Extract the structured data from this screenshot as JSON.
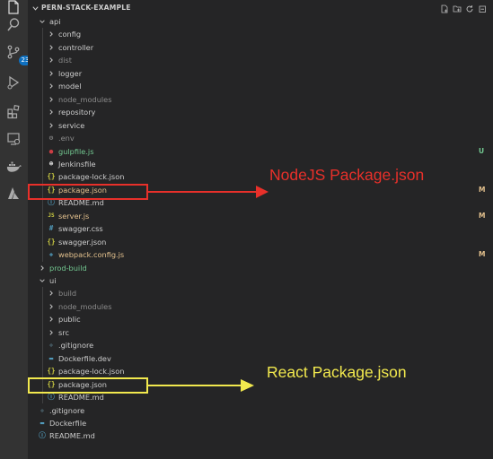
{
  "activity_bar": {
    "items": [
      {
        "name": "files-icon"
      },
      {
        "name": "search-icon"
      },
      {
        "name": "source-control-icon",
        "badge": "23"
      },
      {
        "name": "run-debug-icon"
      },
      {
        "name": "extensions-icon"
      },
      {
        "name": "remote-explorer-icon"
      },
      {
        "name": "docker-icon"
      },
      {
        "name": "azure-icon"
      }
    ]
  },
  "explorer": {
    "root": "PERN-STACK-EXAMPLE",
    "tree": [
      {
        "label": "api",
        "type": "folder",
        "open": true,
        "depth": 0
      },
      {
        "label": "config",
        "type": "folder",
        "open": false,
        "depth": 1
      },
      {
        "label": "controller",
        "type": "folder",
        "open": false,
        "depth": 1
      },
      {
        "label": "dist",
        "type": "folder",
        "open": false,
        "depth": 1,
        "dim": true
      },
      {
        "label": "logger",
        "type": "folder",
        "open": false,
        "depth": 1
      },
      {
        "label": "model",
        "type": "folder",
        "open": false,
        "depth": 1
      },
      {
        "label": "node_modules",
        "type": "folder",
        "open": false,
        "depth": 1,
        "dim": true
      },
      {
        "label": "repository",
        "type": "folder",
        "open": false,
        "depth": 1
      },
      {
        "label": "service",
        "type": "folder",
        "open": false,
        "depth": 1
      },
      {
        "label": ".env",
        "type": "file",
        "icon": "gear",
        "depth": 1,
        "dim": true
      },
      {
        "label": "gulpfile.js",
        "type": "file",
        "icon": "gulp",
        "depth": 1,
        "color": "untracked",
        "status": "U"
      },
      {
        "label": "Jenkinsfile",
        "type": "file",
        "icon": "jenkins",
        "depth": 1
      },
      {
        "label": "package-lock.json",
        "type": "file",
        "icon": "json",
        "depth": 1
      },
      {
        "label": "package.json",
        "type": "file",
        "icon": "json",
        "depth": 1,
        "color": "modified",
        "status": "M"
      },
      {
        "label": "README.md",
        "type": "file",
        "icon": "info",
        "depth": 1
      },
      {
        "label": "server.js",
        "type": "file",
        "icon": "js",
        "depth": 1,
        "color": "modified",
        "status": "M"
      },
      {
        "label": "swagger.css",
        "type": "file",
        "icon": "hash",
        "depth": 1
      },
      {
        "label": "swagger.json",
        "type": "file",
        "icon": "json",
        "depth": 1
      },
      {
        "label": "webpack.config.js",
        "type": "file",
        "icon": "webpack",
        "depth": 1,
        "color": "modified",
        "status": "M"
      },
      {
        "label": "prod-build",
        "type": "folder",
        "open": false,
        "depth": 0,
        "color": "untracked"
      },
      {
        "label": "ui",
        "type": "folder",
        "open": true,
        "depth": 0
      },
      {
        "label": "build",
        "type": "folder",
        "open": false,
        "depth": 1,
        "dim": true
      },
      {
        "label": "node_modules",
        "type": "folder",
        "open": false,
        "depth": 1,
        "dim": true
      },
      {
        "label": "public",
        "type": "folder",
        "open": false,
        "depth": 1
      },
      {
        "label": "src",
        "type": "folder",
        "open": false,
        "depth": 1
      },
      {
        "label": ".gitignore",
        "type": "file",
        "icon": "git",
        "depth": 1
      },
      {
        "label": "Dockerfile.dev",
        "type": "file",
        "icon": "docker",
        "depth": 1
      },
      {
        "label": "package-lock.json",
        "type": "file",
        "icon": "json",
        "depth": 1
      },
      {
        "label": "package.json",
        "type": "file",
        "icon": "json",
        "depth": 1
      },
      {
        "label": "README.md",
        "type": "file",
        "icon": "info",
        "depth": 1
      },
      {
        "label": ".gitignore",
        "type": "file",
        "icon": "git",
        "depth": 0
      },
      {
        "label": "Dockerfile",
        "type": "file",
        "icon": "docker",
        "depth": 0
      },
      {
        "label": "README.md",
        "type": "file",
        "icon": "info",
        "depth": 0
      }
    ]
  },
  "annotations": {
    "node": {
      "text": "NodeJS Package.json",
      "color": "#e8302a"
    },
    "react": {
      "text": "React Package.json",
      "color": "#f2e94e"
    }
  },
  "colors": {
    "modified": "#e2c08d",
    "untracked": "#73c991",
    "sidebar": "#252526",
    "activity_bar": "#333333"
  }
}
